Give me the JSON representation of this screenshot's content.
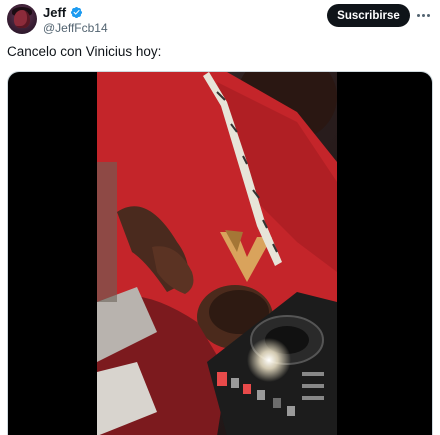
{
  "author": {
    "display_name": "Jeff",
    "handle": "@JeffFcb14",
    "verified": true,
    "verified_color": "#1d9bf0"
  },
  "actions": {
    "subscribe_label": "Suscribirse",
    "more_icon": "more-horizontal-icon"
  },
  "tweet": {
    "text": "Cancelo con Vinicius hoy:"
  },
  "media": {
    "type": "video"
  },
  "colors": {
    "text_primary": "#0f1419",
    "text_secondary": "#536471",
    "button_bg": "#0f1419",
    "button_text": "#ffffff"
  }
}
